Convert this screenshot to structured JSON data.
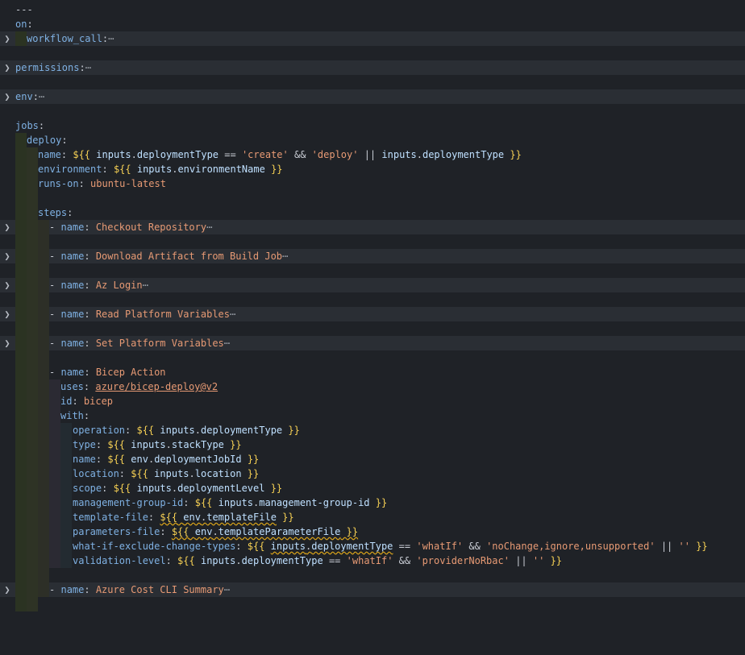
{
  "lines": {
    "l0": "---",
    "on": "on",
    "workflow_call": "workflow_call",
    "permissions": "permissions",
    "env": "env",
    "jobs": "jobs",
    "deploy": "deploy",
    "name_key": "name",
    "environment_key": "environment",
    "runs_on_key": "runs-on",
    "runs_on_val": "ubuntu-latest",
    "steps": "steps",
    "dash": "-",
    "step1": "Checkout Repository",
    "step2": "Download Artifact from Build Job",
    "step3": "Az Login",
    "step4": "Read Platform Variables",
    "step5": "Set Platform Variables",
    "step6": "Bicep Action",
    "uses_key": "uses",
    "uses_val": "azure/bicep-deploy@v2",
    "id_key": "id",
    "id_val": "bicep",
    "with_key": "with",
    "step7": "Azure Cost CLI Summary",
    "ellipsis": "⋯"
  },
  "expr": {
    "open": "${{",
    "close": "}}",
    "inputs": "inputs",
    "env": "env",
    "deploymentType": "deploymentType",
    "environmentName": "environmentName",
    "stackType": "stackType",
    "deploymentJobId": "deploymentJobId",
    "location": "location",
    "deploymentLevel": "deploymentLevel",
    "managementGroupId": "management-group-id",
    "templateFile": "templateFile",
    "templateParameterFile": "templateParameterFile",
    "eq": "==",
    "and": "&&",
    "or": "||",
    "create": "'create'",
    "deploy": "'deploy'",
    "whatIf": "'whatIf'",
    "noChange": "'noChange,ignore,unsupported'",
    "empty": "''",
    "providerNoRbac": "'providerNoRbac'"
  },
  "with_keys": {
    "operation": "operation",
    "type": "type",
    "name": "name",
    "location": "location",
    "scope": "scope",
    "management_group_id": "management-group-id",
    "template_file": "template-file",
    "parameters_file": "parameters-file",
    "what_if": "what-if-exclude-change-types",
    "validation_level": "validation-level"
  },
  "colors": {
    "background": "#1f2227",
    "key": "#7fb1e3",
    "string": "#e79a74",
    "brace": "#f7d154",
    "variable": "#bfe0ff"
  }
}
